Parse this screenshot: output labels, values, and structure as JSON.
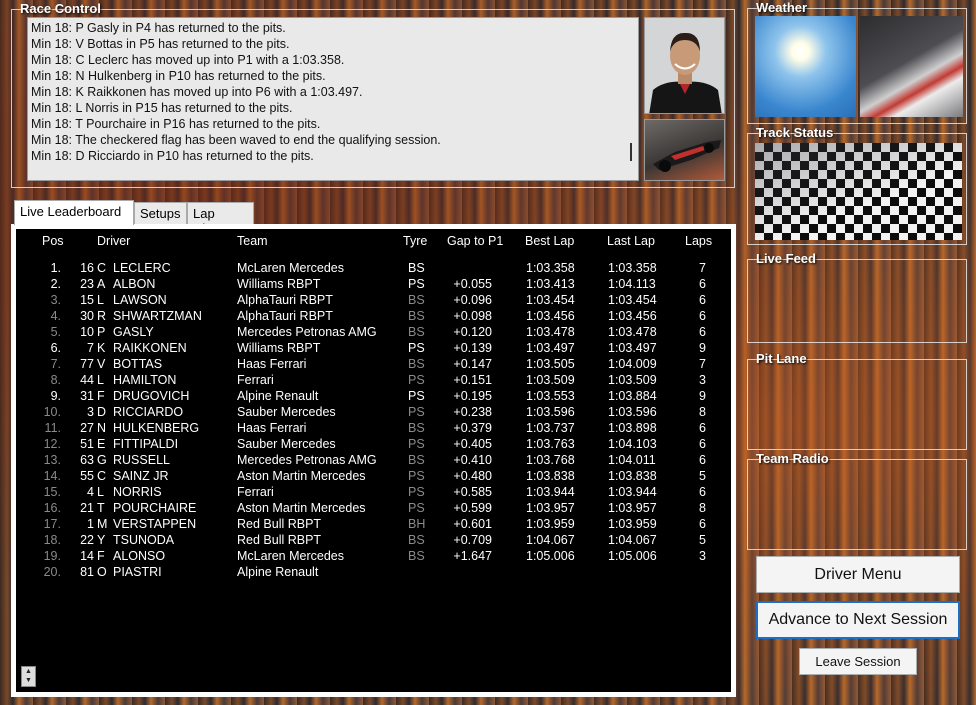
{
  "race_control": {
    "title": "Race Control",
    "messages": [
      "Min 18: P Gasly in P4 has returned to the pits.",
      "Min 18: V Bottas in P5 has returned to the pits.",
      "Min 18: C Leclerc has moved up into P1 with a 1:03.358.",
      "Min 18: N Hulkenberg in P10 has returned to the pits.",
      "Min 18: K Raikkonen has moved up into P6 with a 1:03.497.",
      "Min 18: L Norris in P15 has returned to the pits.",
      "Min 18: T Pourchaire in P16 has returned to the pits.",
      "Min 18: The checkered flag has been waved to end the qualifying session.",
      "Min 18: D Ricciardo in P10 has returned to the pits."
    ]
  },
  "tabs": [
    "Live Leaderboard",
    "Setups",
    "Lap Chart"
  ],
  "leaderboard": {
    "headers": [
      "Pos",
      "Driver",
      "Team",
      "Tyre",
      "Gap to P1",
      "Best Lap",
      "Last Lap",
      "Laps"
    ],
    "rows": [
      {
        "pos": "1.",
        "num": "16",
        "init": "C",
        "name": "LECLERC",
        "team": "McLaren Mercedes",
        "tyre": "BS",
        "gap": "",
        "best": "1:03.358",
        "last": "1:03.358",
        "laps": "7",
        "dim": false
      },
      {
        "pos": "2.",
        "num": "23",
        "init": "A",
        "name": "ALBON",
        "team": "Williams RBPT",
        "tyre": "PS",
        "gap": "+0.055",
        "best": "1:03.413",
        "last": "1:04.113",
        "laps": "6",
        "dim": false
      },
      {
        "pos": "3.",
        "num": "15",
        "init": "L",
        "name": "LAWSON",
        "team": "AlphaTauri RBPT",
        "tyre": "BS",
        "gap": "+0.096",
        "best": "1:03.454",
        "last": "1:03.454",
        "laps": "6",
        "dim": true
      },
      {
        "pos": "4.",
        "num": "30",
        "init": "R",
        "name": "SHWARTZMAN",
        "team": "AlphaTauri RBPT",
        "tyre": "BS",
        "gap": "+0.098",
        "best": "1:03.456",
        "last": "1:03.456",
        "laps": "6",
        "dim": true
      },
      {
        "pos": "5.",
        "num": "10",
        "init": "P",
        "name": "GASLY",
        "team": "Mercedes Petronas AMG",
        "tyre": "BS",
        "gap": "+0.120",
        "best": "1:03.478",
        "last": "1:03.478",
        "laps": "6",
        "dim": true
      },
      {
        "pos": "6.",
        "num": "7",
        "init": "K",
        "name": "RAIKKONEN",
        "team": "Williams RBPT",
        "tyre": "PS",
        "gap": "+0.139",
        "best": "1:03.497",
        "last": "1:03.497",
        "laps": "9",
        "dim": false
      },
      {
        "pos": "7.",
        "num": "77",
        "init": "V",
        "name": "BOTTAS",
        "team": "Haas Ferrari",
        "tyre": "BS",
        "gap": "+0.147",
        "best": "1:03.505",
        "last": "1:04.009",
        "laps": "7",
        "dim": true
      },
      {
        "pos": "8.",
        "num": "44",
        "init": "L",
        "name": "HAMILTON",
        "team": "Ferrari",
        "tyre": "PS",
        "gap": "+0.151",
        "best": "1:03.509",
        "last": "1:03.509",
        "laps": "3",
        "dim": true
      },
      {
        "pos": "9.",
        "num": "31",
        "init": "F",
        "name": "DRUGOVICH",
        "team": "Alpine Renault",
        "tyre": "PS",
        "gap": "+0.195",
        "best": "1:03.553",
        "last": "1:03.884",
        "laps": "9",
        "dim": false
      },
      {
        "pos": "10.",
        "num": "3",
        "init": "D",
        "name": "RICCIARDO",
        "team": "Sauber Mercedes",
        "tyre": "PS",
        "gap": "+0.238",
        "best": "1:03.596",
        "last": "1:03.596",
        "laps": "8",
        "dim": true
      },
      {
        "pos": "11.",
        "num": "27",
        "init": "N",
        "name": "HULKENBERG",
        "team": "Haas Ferrari",
        "tyre": "BS",
        "gap": "+0.379",
        "best": "1:03.737",
        "last": "1:03.898",
        "laps": "6",
        "dim": true
      },
      {
        "pos": "12.",
        "num": "51",
        "init": "E",
        "name": "FITTIPALDI",
        "team": "Sauber Mercedes",
        "tyre": "PS",
        "gap": "+0.405",
        "best": "1:03.763",
        "last": "1:04.103",
        "laps": "6",
        "dim": true
      },
      {
        "pos": "13.",
        "num": "63",
        "init": "G",
        "name": "RUSSELL",
        "team": "Mercedes Petronas AMG",
        "tyre": "BS",
        "gap": "+0.410",
        "best": "1:03.768",
        "last": "1:04.011",
        "laps": "6",
        "dim": true
      },
      {
        "pos": "14.",
        "num": "55",
        "init": "C",
        "name": "SAINZ JR",
        "team": "Aston Martin Mercedes",
        "tyre": "PS",
        "gap": "+0.480",
        "best": "1:03.838",
        "last": "1:03.838",
        "laps": "5",
        "dim": true
      },
      {
        "pos": "15.",
        "num": "4",
        "init": "L",
        "name": "NORRIS",
        "team": "Ferrari",
        "tyre": "PS",
        "gap": "+0.585",
        "best": "1:03.944",
        "last": "1:03.944",
        "laps": "6",
        "dim": true
      },
      {
        "pos": "16.",
        "num": "21",
        "init": "T",
        "name": "POURCHAIRE",
        "team": "Aston Martin Mercedes",
        "tyre": "PS",
        "gap": "+0.599",
        "best": "1:03.957",
        "last": "1:03.957",
        "laps": "8",
        "dim": true
      },
      {
        "pos": "17.",
        "num": "1",
        "init": "M",
        "name": "VERSTAPPEN",
        "team": "Red Bull RBPT",
        "tyre": "BH",
        "gap": "+0.601",
        "best": "1:03.959",
        "last": "1:03.959",
        "laps": "6",
        "dim": true
      },
      {
        "pos": "18.",
        "num": "22",
        "init": "Y",
        "name": "TSUNODA",
        "team": "Red Bull RBPT",
        "tyre": "BS",
        "gap": "+0.709",
        "best": "1:04.067",
        "last": "1:04.067",
        "laps": "5",
        "dim": true
      },
      {
        "pos": "19.",
        "num": "14",
        "init": "F",
        "name": "ALONSO",
        "team": "McLaren Mercedes",
        "tyre": "BS",
        "gap": "+1.647",
        "best": "1:05.006",
        "last": "1:05.006",
        "laps": "3",
        "dim": true
      },
      {
        "pos": "20.",
        "num": "81",
        "init": "O",
        "name": "PIASTRI",
        "team": "Alpine Renault",
        "tyre": "",
        "gap": "",
        "best": "",
        "last": "",
        "laps": "",
        "dim": true
      }
    ]
  },
  "panels": {
    "weather": "Weather",
    "track_status": "Track Status",
    "live_feed": "Live Feed",
    "pit_lane": "Pit Lane",
    "team_radio": "Team Radio"
  },
  "buttons": {
    "driver_menu": "Driver Menu",
    "advance": "Advance to Next Session",
    "leave": "Leave Session"
  },
  "spinner": {
    "up": "▲",
    "down": "▼"
  }
}
